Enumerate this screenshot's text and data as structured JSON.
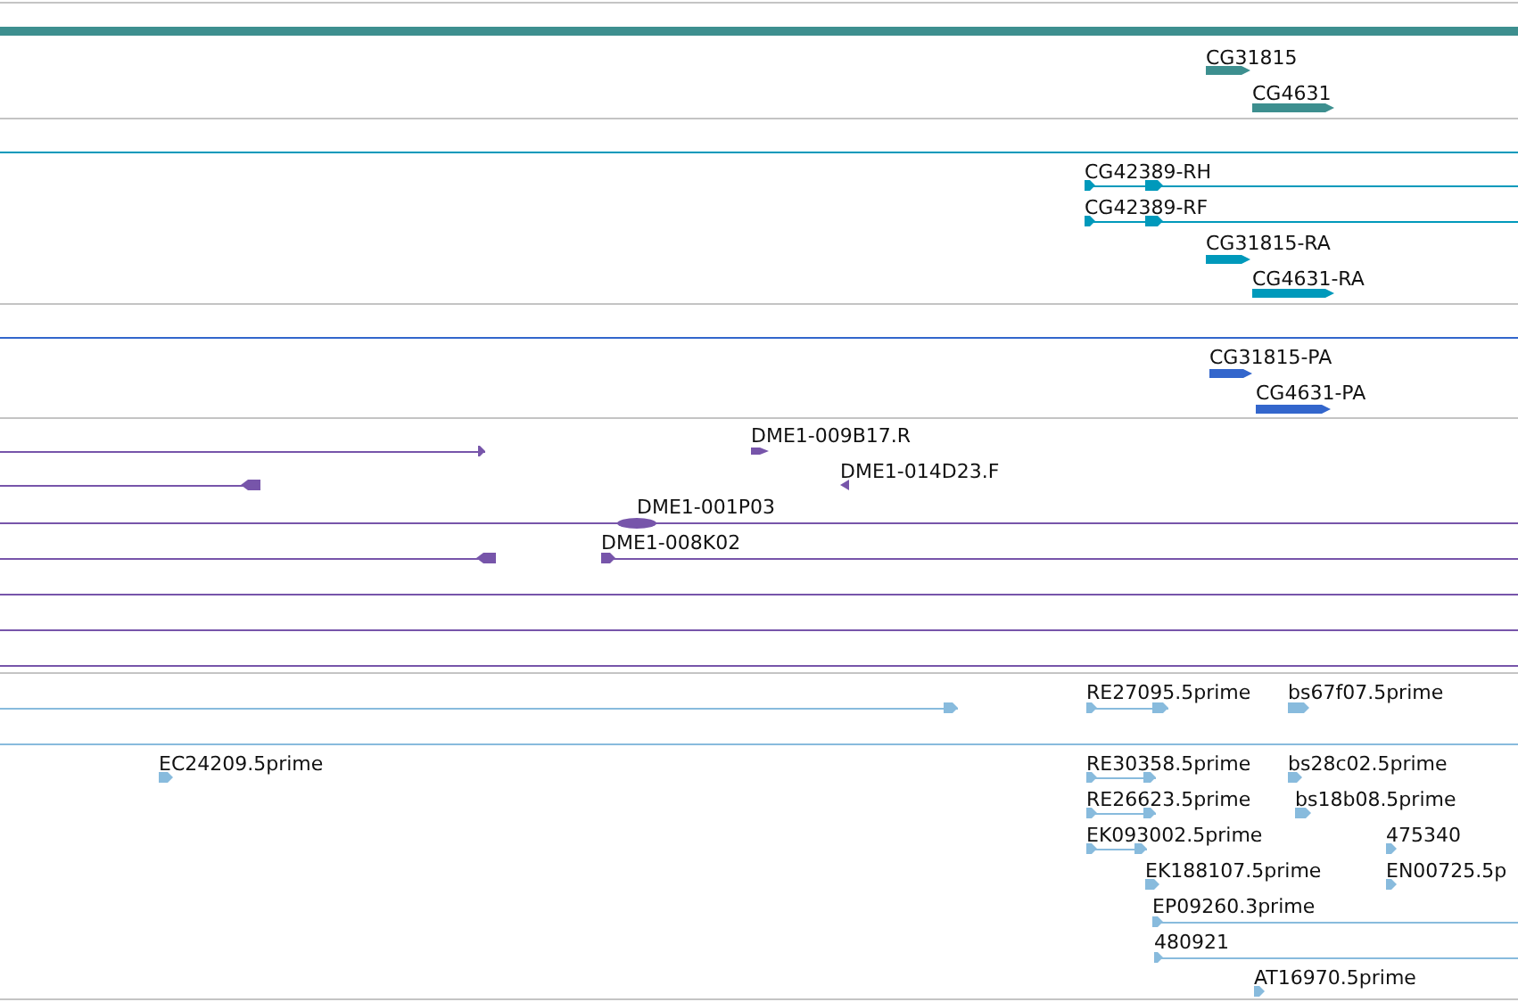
{
  "tracks": [
    {
      "color": "#3d8f8f",
      "features": [
        {
          "label": "CG31815"
        },
        {
          "label": "CG4631"
        }
      ]
    },
    {
      "color": "#0099bb",
      "features": [
        {
          "label": "CG42389-RH"
        },
        {
          "label": "CG42389-RF"
        },
        {
          "label": "CG31815-RA"
        },
        {
          "label": "CG4631-RA"
        }
      ]
    },
    {
      "color": "#3366cc",
      "features": [
        {
          "label": "CG31815-PA"
        },
        {
          "label": "CG4631-PA"
        }
      ]
    },
    {
      "color": "#7755aa",
      "features": [
        {
          "label": "DME1-009B17.R"
        },
        {
          "label": "DME1-014D23.F"
        },
        {
          "label": "DME1-001P03"
        },
        {
          "label": "DME1-008K02"
        }
      ]
    },
    {
      "color": "#88bbdd",
      "features": [
        {
          "label": "RE27095.5prime"
        },
        {
          "label": "bs67f07.5prime"
        },
        {
          "label": "EC24209.5prime"
        },
        {
          "label": "RE30358.5prime"
        },
        {
          "label": "bs28c02.5prime"
        },
        {
          "label": "RE26623.5prime"
        },
        {
          "label": "bs18b08.5prime"
        },
        {
          "label": "EK093002.5prime"
        },
        {
          "label": "475340"
        },
        {
          "label": "EK188107.5prime"
        },
        {
          "label": "EN00725.5p"
        },
        {
          "label": "EP09260.3prime"
        },
        {
          "label": "480921"
        },
        {
          "label": "AT16970.5prime"
        }
      ]
    }
  ]
}
